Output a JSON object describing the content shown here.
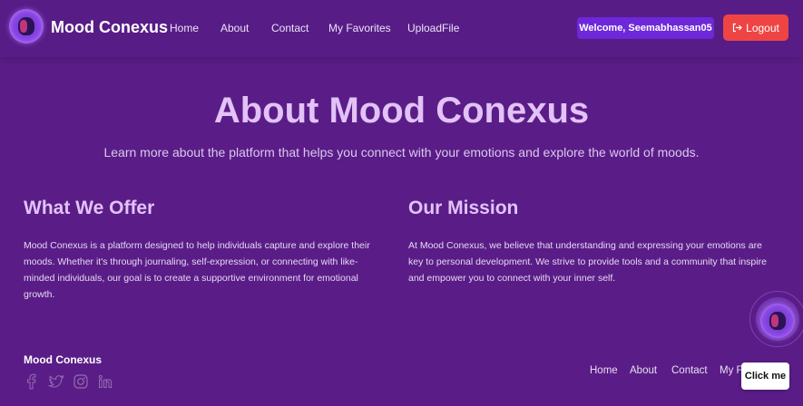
{
  "nav": {
    "brand": "Mood Conexus",
    "links": [
      "Home",
      "About",
      "Contact",
      "My Favorites",
      "UploadFile"
    ],
    "welcome": "Welcome, Seemabhassan05",
    "logout_label": "Logout"
  },
  "hero": {
    "title": "About Mood Conexus",
    "subtitle": "Learn more about the platform that helps you connect with your emotions and explore the world of moods."
  },
  "sections": [
    {
      "title": "What We Offer",
      "text": "Mood Conexus is a platform designed to help individuals capture and explore their moods. Whether it's through journaling, self-expression, or connecting with like-minded individuals, our goal is to create a supportive environment for emotional growth."
    },
    {
      "title": "Our Mission",
      "text": "At Mood Conexus, we believe that understanding and expressing your emotions are key to personal development. We strive to provide tools and a community that inspire and empower you to connect with your inner self."
    }
  ],
  "footer": {
    "brand": "Mood Conexus",
    "social_icons": [
      "facebook-icon",
      "twitter-icon",
      "instagram-icon",
      "linkedin-icon"
    ],
    "links": [
      "Home",
      "About",
      "Contact",
      "My F"
    ]
  },
  "widget": {
    "button_label": "Click me"
  },
  "colors": {
    "background": "#5a1d87",
    "heading": "#e2c2f7",
    "welcome_badge": "#6d28d9",
    "logout": "#ef4444"
  }
}
